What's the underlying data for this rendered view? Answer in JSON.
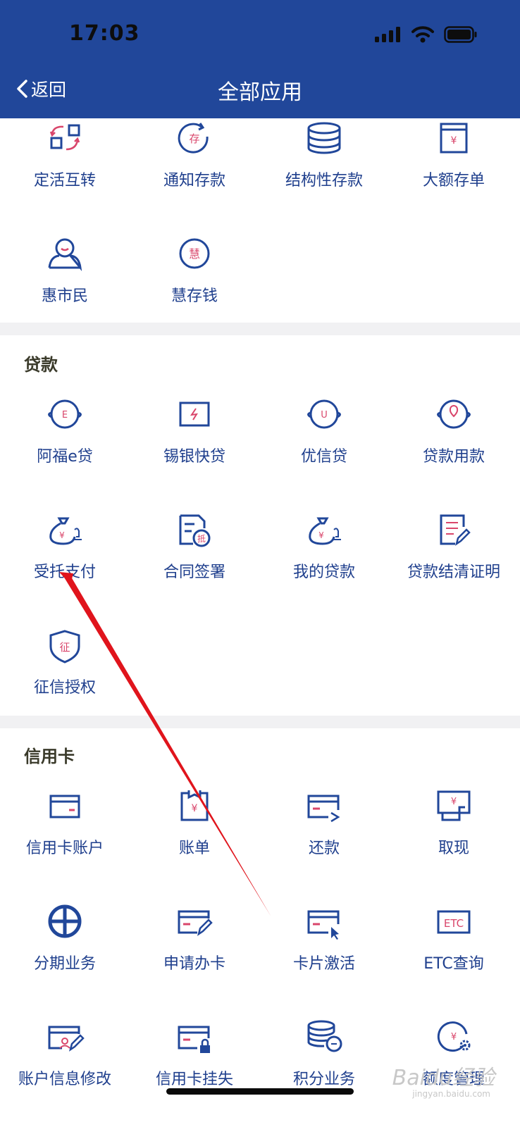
{
  "status": {
    "time": "17:03"
  },
  "header": {
    "back": "返回",
    "title": "全部应用"
  },
  "deposit": {
    "items": [
      {
        "label": "定活互转",
        "icon": "transfer-icon"
      },
      {
        "label": "通知存款",
        "icon": "notice-deposit-icon"
      },
      {
        "label": "结构性存款",
        "icon": "coin-stack-icon"
      },
      {
        "label": "大额存单",
        "icon": "certificate-icon"
      },
      {
        "label": "惠市民",
        "icon": "citizen-icon"
      },
      {
        "label": "慧存钱",
        "icon": "hui-deposit-icon"
      }
    ],
    "glyphs": {
      "cun": "存",
      "hui": "慧",
      "yen": "¥"
    }
  },
  "loan": {
    "title": "贷款",
    "items": [
      {
        "label": "阿福e贷",
        "icon": "afu-loan-icon"
      },
      {
        "label": "锡银快贷",
        "icon": "quick-loan-icon"
      },
      {
        "label": "优信贷",
        "icon": "credit-loan-icon"
      },
      {
        "label": "贷款用款",
        "icon": "loan-use-icon"
      },
      {
        "label": "受托支付",
        "icon": "money-bag-icon"
      },
      {
        "label": "合同签署",
        "icon": "contract-icon"
      },
      {
        "label": "我的贷款",
        "icon": "my-loan-icon"
      },
      {
        "label": "贷款结清证明",
        "icon": "settlement-icon"
      },
      {
        "label": "征信授权",
        "icon": "shield-icon"
      }
    ],
    "glyphs": {
      "e": "E",
      "u": "U",
      "di": "抵",
      "zheng": "征",
      "yen": "¥"
    }
  },
  "credit": {
    "title": "信用卡",
    "items": [
      {
        "label": "信用卡账户",
        "icon": "card-account-icon"
      },
      {
        "label": "账单",
        "icon": "bill-icon"
      },
      {
        "label": "还款",
        "icon": "repayment-icon"
      },
      {
        "label": "取现",
        "icon": "cash-withdraw-icon"
      },
      {
        "label": "分期业务",
        "icon": "installment-icon"
      },
      {
        "label": "申请办卡",
        "icon": "apply-card-icon"
      },
      {
        "label": "卡片激活",
        "icon": "activate-card-icon"
      },
      {
        "label": "ETC查询",
        "icon": "etc-icon"
      },
      {
        "label": "账户信息修改",
        "icon": "account-edit-icon"
      },
      {
        "label": "信用卡挂失",
        "icon": "card-lock-icon"
      },
      {
        "label": "积分业务",
        "icon": "points-icon"
      },
      {
        "label": "额度管理",
        "icon": "limit-icon"
      }
    ],
    "glyphs": {
      "etc": "ETC",
      "yen": "¥"
    }
  },
  "watermark": {
    "brand": "Baidu经验",
    "url": "jingyan.baidu.com"
  },
  "colors": {
    "header": "#21479a",
    "icon": "#21479a",
    "accent": "#d9466b",
    "separator": "#f1f1f3"
  }
}
